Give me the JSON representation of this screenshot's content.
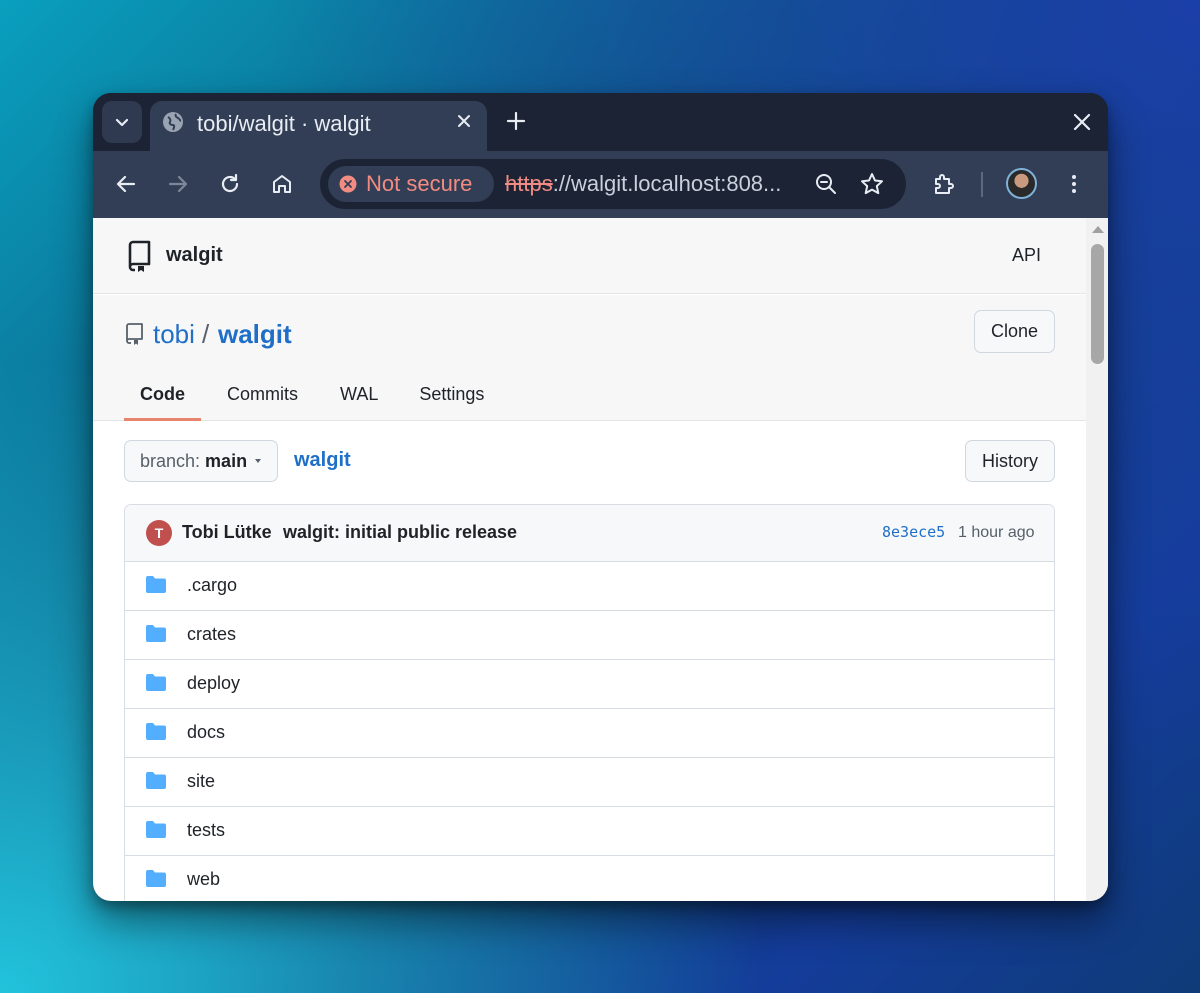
{
  "browser": {
    "tab_title": "tobi/walgit · walgit",
    "security_chip": "Not secure",
    "url_scheme": "https",
    "url_rest": "://walgit.localhost:808..."
  },
  "header": {
    "logo_text": "walgit",
    "api_label": "API"
  },
  "repo": {
    "owner": "tobi",
    "separator": "/",
    "name": "walgit",
    "clone_label": "Clone",
    "tabs": [
      {
        "label": "Code"
      },
      {
        "label": "Commits"
      },
      {
        "label": "WAL"
      },
      {
        "label": "Settings"
      }
    ]
  },
  "browser_bar": {
    "branch_prefix": "branch:",
    "branch_name": "main",
    "path": "walgit",
    "history_label": "History"
  },
  "commit": {
    "avatar_letter": "T",
    "author": "Tobi Lütke",
    "message": "walgit: initial public release",
    "sha": "8e3ece5",
    "time": "1 hour ago"
  },
  "files": [
    {
      "name": ".cargo"
    },
    {
      "name": "crates"
    },
    {
      "name": "deploy"
    },
    {
      "name": "docs"
    },
    {
      "name": "site"
    },
    {
      "name": "tests"
    },
    {
      "name": "web"
    }
  ],
  "colors": {
    "link": "#1f6fc8",
    "folder": "#54aeff",
    "active_tab_underline": "#e8846e",
    "insecure": "#f28b82"
  }
}
